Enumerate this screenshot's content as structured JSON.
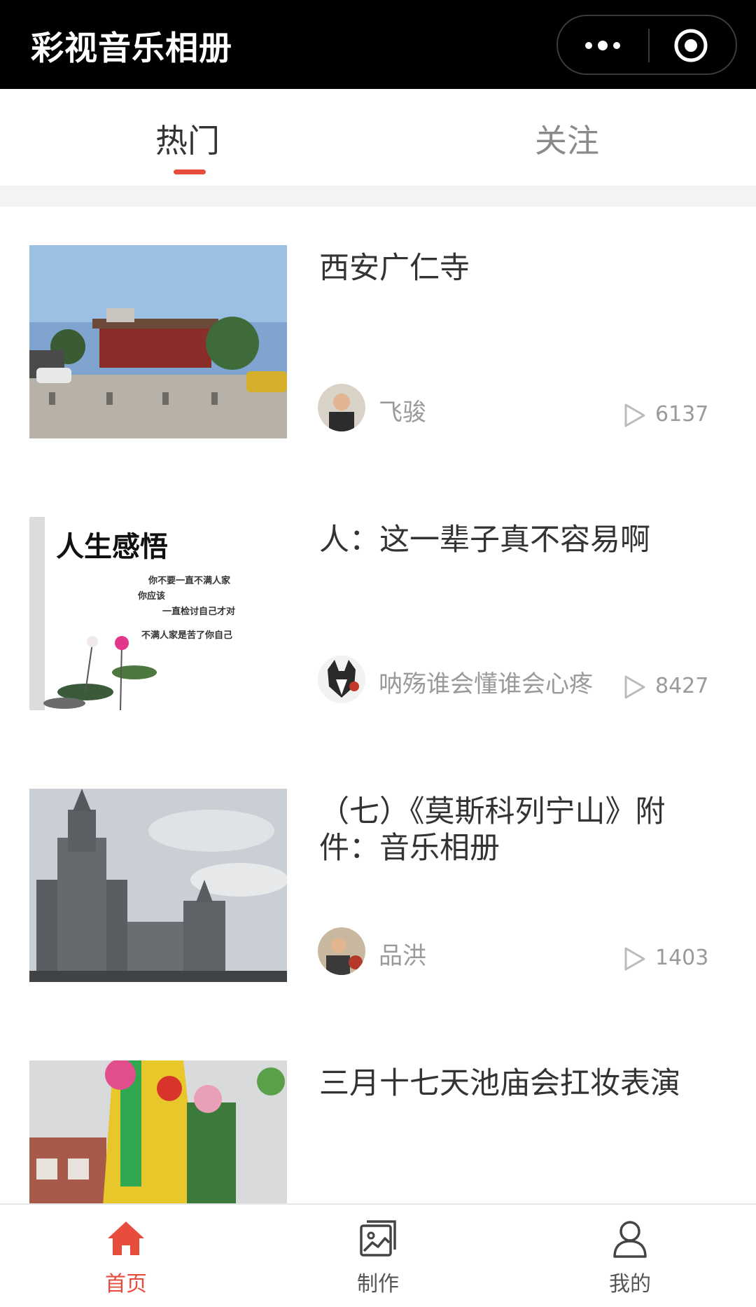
{
  "app": {
    "title": "彩视音乐相册"
  },
  "tabs": [
    {
      "label": "热门",
      "active": true
    },
    {
      "label": "关注",
      "active": false
    }
  ],
  "feed": [
    {
      "title": "西安广仁寺",
      "author": "飞骏",
      "plays": "6137"
    },
    {
      "title": "人：这一辈子真不容易啊",
      "author": "呐殇谁会懂谁会心疼",
      "plays": "8427",
      "thumb_text": {
        "heading": "人生感悟",
        "lines": [
          "你不要一直不满人家",
          "你应该",
          "一直检讨自己才对",
          "不满人家是苦了你自己"
        ]
      }
    },
    {
      "title": "（七）《莫斯科列宁山》附件：音乐相册",
      "author": "品洪",
      "plays": "1403"
    },
    {
      "title": "三月十七天池庙会扛妆表演",
      "author": "",
      "plays": ""
    }
  ],
  "bottom_nav": [
    {
      "label": "首页",
      "icon": "home-icon",
      "active": true
    },
    {
      "label": "制作",
      "icon": "photo-album-icon",
      "active": false
    },
    {
      "label": "我的",
      "icon": "user-icon",
      "active": false
    }
  ],
  "colors": {
    "accent": "#e74c3c",
    "topbar": "#000000"
  }
}
